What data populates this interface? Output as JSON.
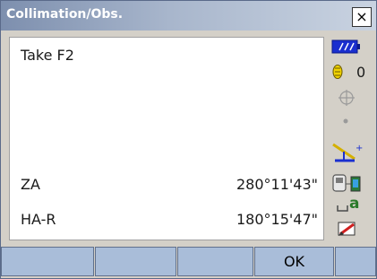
{
  "window": {
    "title": "Collimation/Obs.",
    "close_label": "×"
  },
  "screen": {
    "message": "Take F2",
    "rows": [
      {
        "label": "ZA",
        "value": "280°11'43\""
      },
      {
        "label": "HA-R",
        "value": "180°15'47\""
      }
    ]
  },
  "status": {
    "battery_icon": "battery-icon",
    "prism_constant": "0",
    "target_icon": "crosshair-icon",
    "tilt_icon": "tilt-icon",
    "comm_icon": "bluetooth-icon",
    "input_mode": "a"
  },
  "softkeys": [
    "",
    "",
    "",
    "OK",
    ""
  ],
  "colors": {
    "titlebar_start": "#7d8fae",
    "softkey": "#a9bdd9",
    "battery": "#1a2fcf"
  }
}
